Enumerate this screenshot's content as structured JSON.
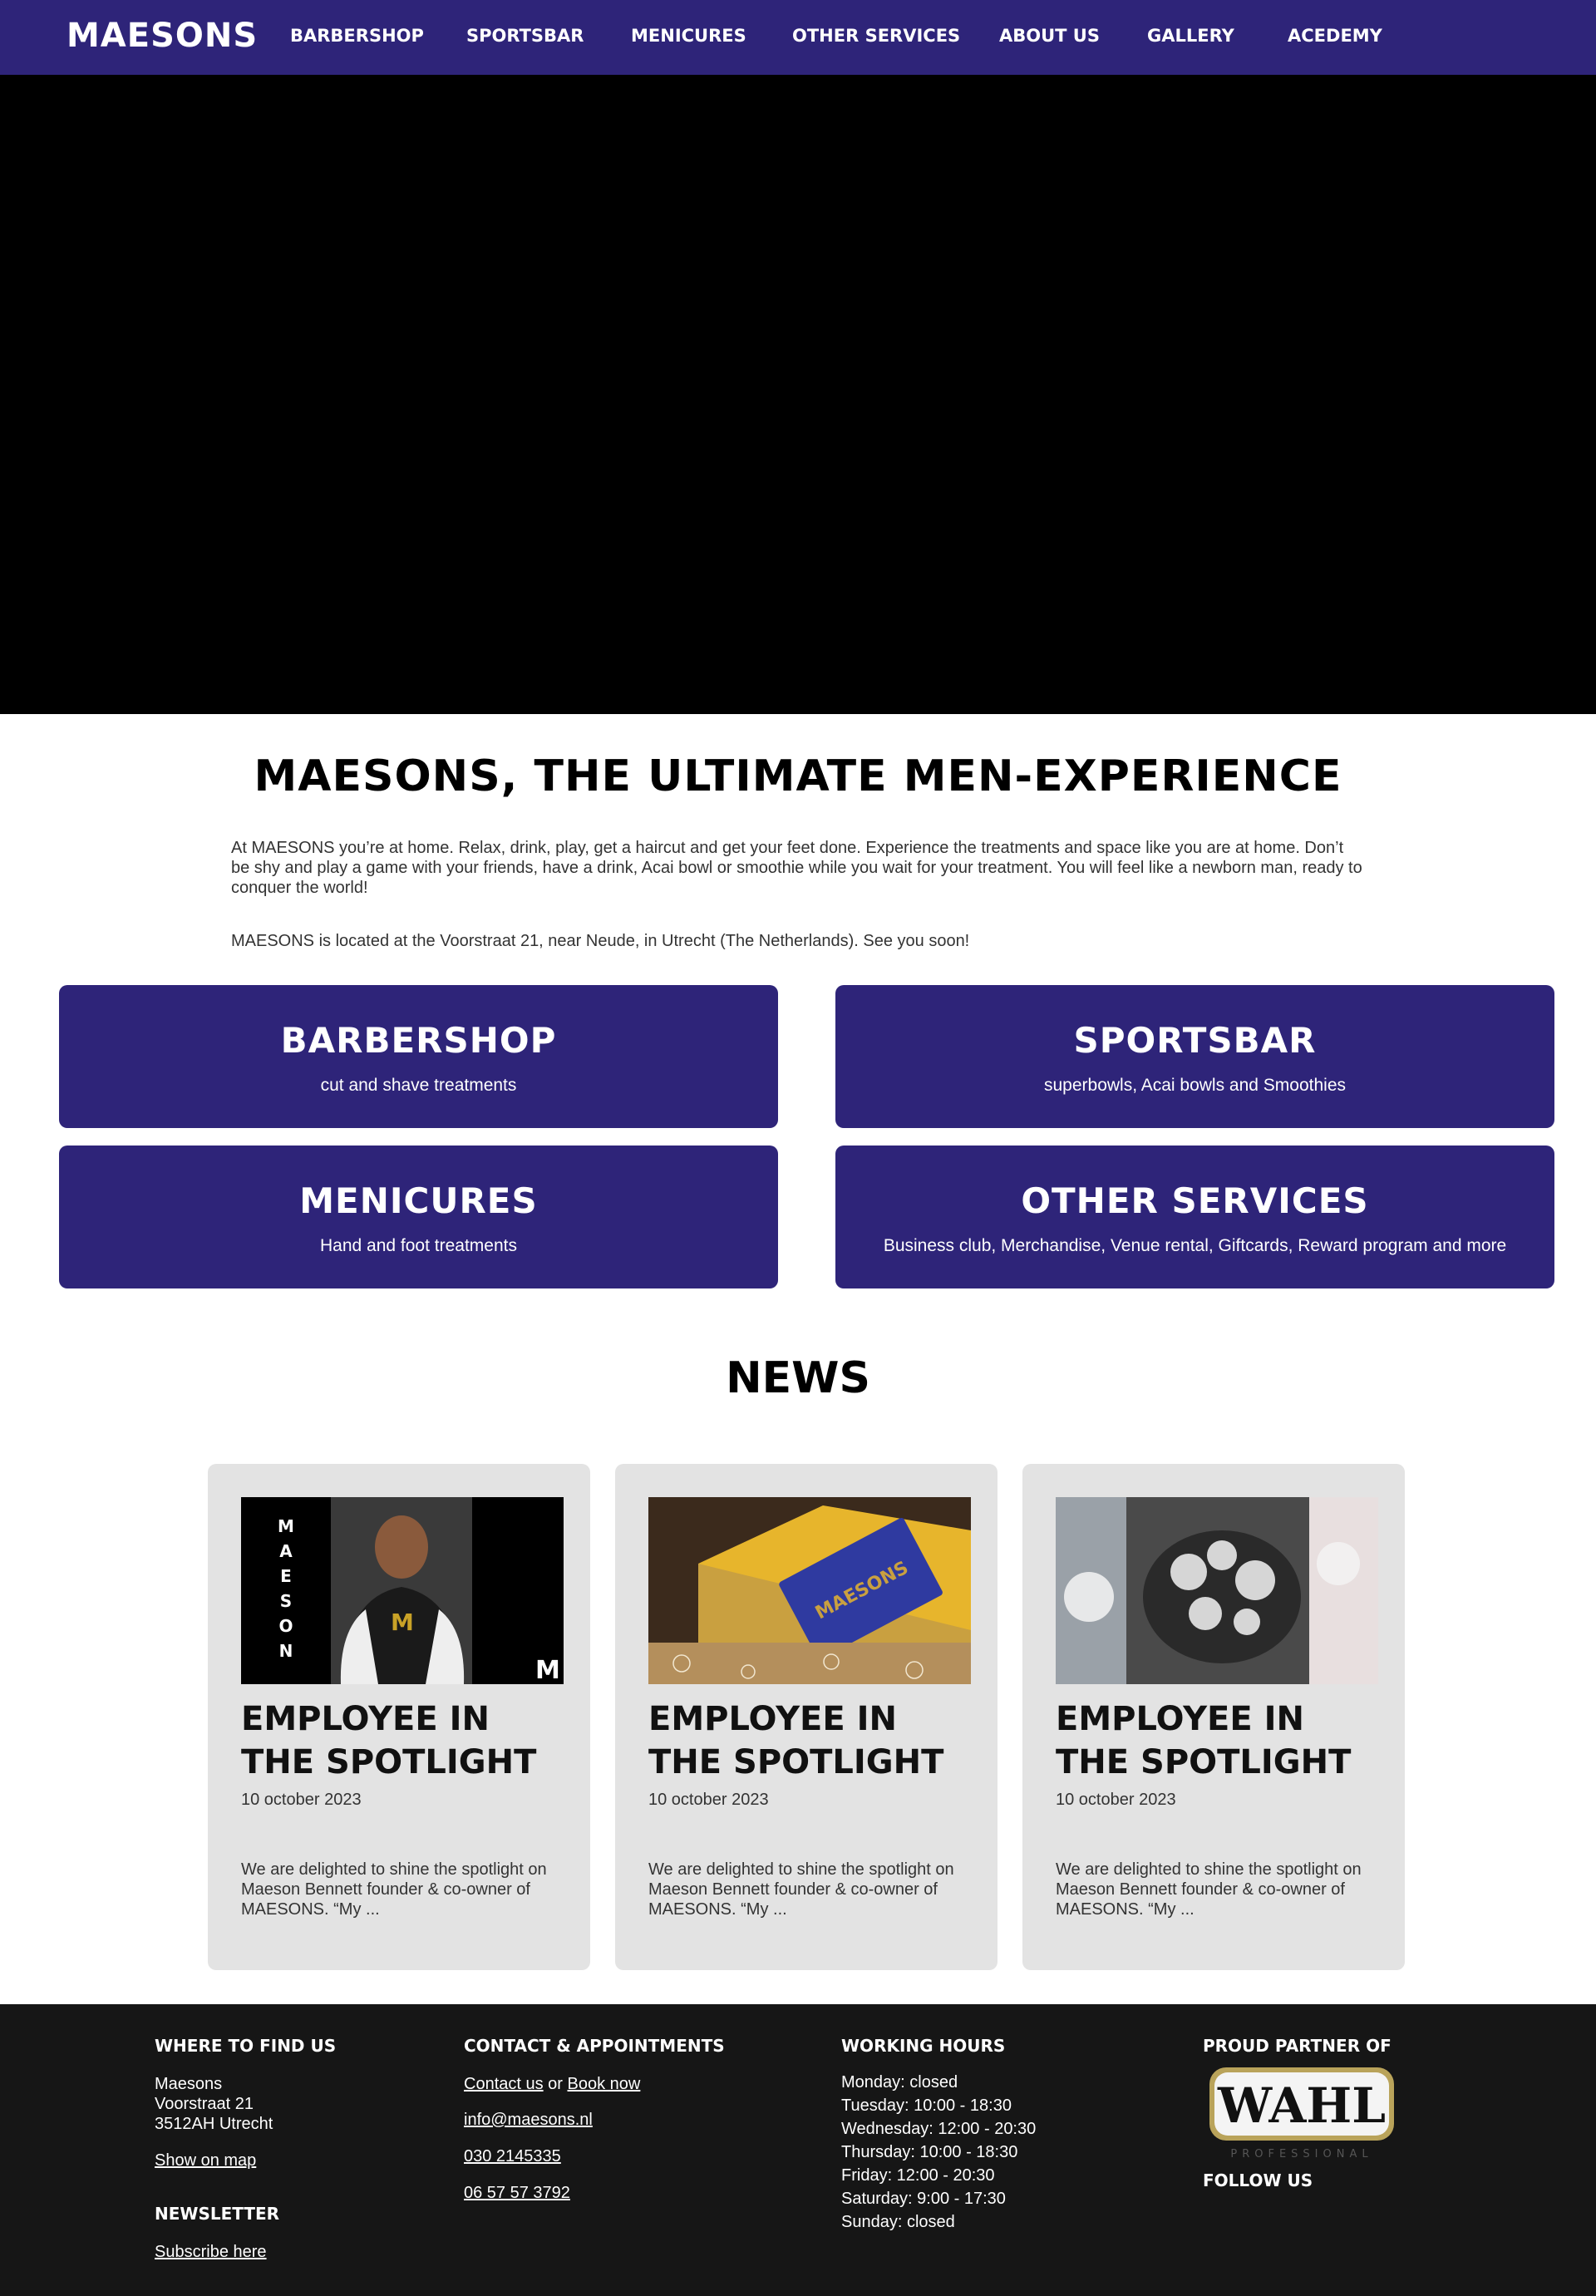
{
  "nav": {
    "logo": "MAESONS",
    "links": [
      "BARBERSHOP",
      "SPORTSBAR",
      "MENICURES",
      "OTHER SERVICES",
      "ABOUT US",
      "GALLERY",
      "ACEDEMY"
    ]
  },
  "intro": {
    "title": "MAESONS, THE ULTIMATE MEN-EXPERIENCE",
    "paragraph1": "At MAESONS you’re at home. Relax, drink, play, get a haircut and get your feet done. Experience the treatments and space like you are at home. Don’t be shy and play a game with your friends, have a drink, Acai bowl or smoothie while you wait for your treatment. You will feel like a newborn man, ready to conquer the world!",
    "paragraph2": "MAESONS is located at the Voorstraat 21, near Neude, in Utrecht (The Netherlands). See you soon!"
  },
  "services": [
    {
      "title": "BARBERSHOP",
      "subtitle": "cut and shave treatments"
    },
    {
      "title": "SPORTSBAR",
      "subtitle": "superbowls, Acai bowls and Smoothies"
    },
    {
      "title": "MENICURES",
      "subtitle": "Hand and foot treatments"
    },
    {
      "title": "OTHER SERVICES",
      "subtitle": "Business club, Merchandise, Venue rental, Giftcards, Reward program and more"
    }
  ],
  "news": {
    "title": "NEWS",
    "items": [
      {
        "title": "EMPLOYEE IN THE SPOTLIGHT",
        "date": "10 october 2023",
        "excerpt": "We are delighted to shine the spotlight on Maeson Bennett founder & co-owner of MAESONS. “My ...",
        "image_text": "MAESON",
        "image_corner": "M"
      },
      {
        "title": "EMPLOYEE IN THE SPOTLIGHT",
        "date": "10 october 2023",
        "excerpt": "We are delighted to shine the spotlight on Maeson Bennett founder & co-owner of MAESONS. “My ...",
        "image_text": "MAESONS"
      },
      {
        "title": "EMPLOYEE IN THE SPOTLIGHT",
        "date": "10 october 2023",
        "excerpt": "We are delighted to shine the spotlight on Maeson Bennett founder & co-owner of MAESONS. “My ..."
      }
    ]
  },
  "footer": {
    "find_us": {
      "heading": "WHERE TO FIND US",
      "name": "Maesons",
      "street": "Voorstraat 21",
      "city": "3512AH Utrecht",
      "map_link": "Show on map"
    },
    "newsletter": {
      "heading": "NEWSLETTER",
      "link": "Subscribe here"
    },
    "contact": {
      "heading": "CONTACT & APPOINTMENTS",
      "contact_link": "Contact us",
      "or_text": "or",
      "book_link": "Book now",
      "email": "info@maesons.nl",
      "phone1": "030 2145335",
      "phone2": "06 57 57 3792"
    },
    "hours": {
      "heading": "WORKING HOURS",
      "lines": [
        "Monday: closed",
        "Tuesday: 10:00 - 18:30",
        "Wednesday: 12:00 - 20:30",
        "Thursday: 10:00 - 18:30",
        "Friday: 12:00 - 20:30",
        "Saturday: 9:00 - 17:30",
        "Sunday: closed"
      ]
    },
    "partner": {
      "heading": "PROUD PARTNER OF",
      "logo_text": "WAHL",
      "logo_sub": "PROFESSIONAL",
      "follow": "FOLLOW US"
    }
  },
  "colors": {
    "brand": "#2e2479",
    "footer_bg": "#161616",
    "card_bg": "#e3e3e3"
  }
}
